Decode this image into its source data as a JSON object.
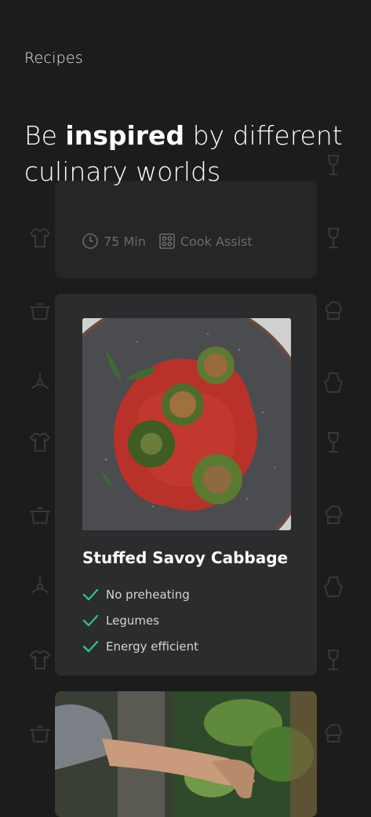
{
  "header": {
    "section_label": "Recipes",
    "headline_pre": "Be ",
    "headline_bold": "inspired",
    "headline_post": " by different culinary worlds"
  },
  "faded_card": {
    "time_label": "75 Min",
    "assist_label": "Cook Assist",
    "time_icon": "clock-icon",
    "assist_icon": "cooktop-icon"
  },
  "recipe_card": {
    "title": "Stuffed Savoy Cabbage",
    "features": [
      {
        "label": "No preheating",
        "icon": "check-icon"
      },
      {
        "label": "Legumes",
        "icon": "check-icon"
      },
      {
        "label": "Energy efficient",
        "icon": "check-icon"
      }
    ],
    "accent_color": "#2ec27e"
  },
  "theme": {
    "background": "#1c1c1c",
    "card": "#2a2c2e"
  }
}
